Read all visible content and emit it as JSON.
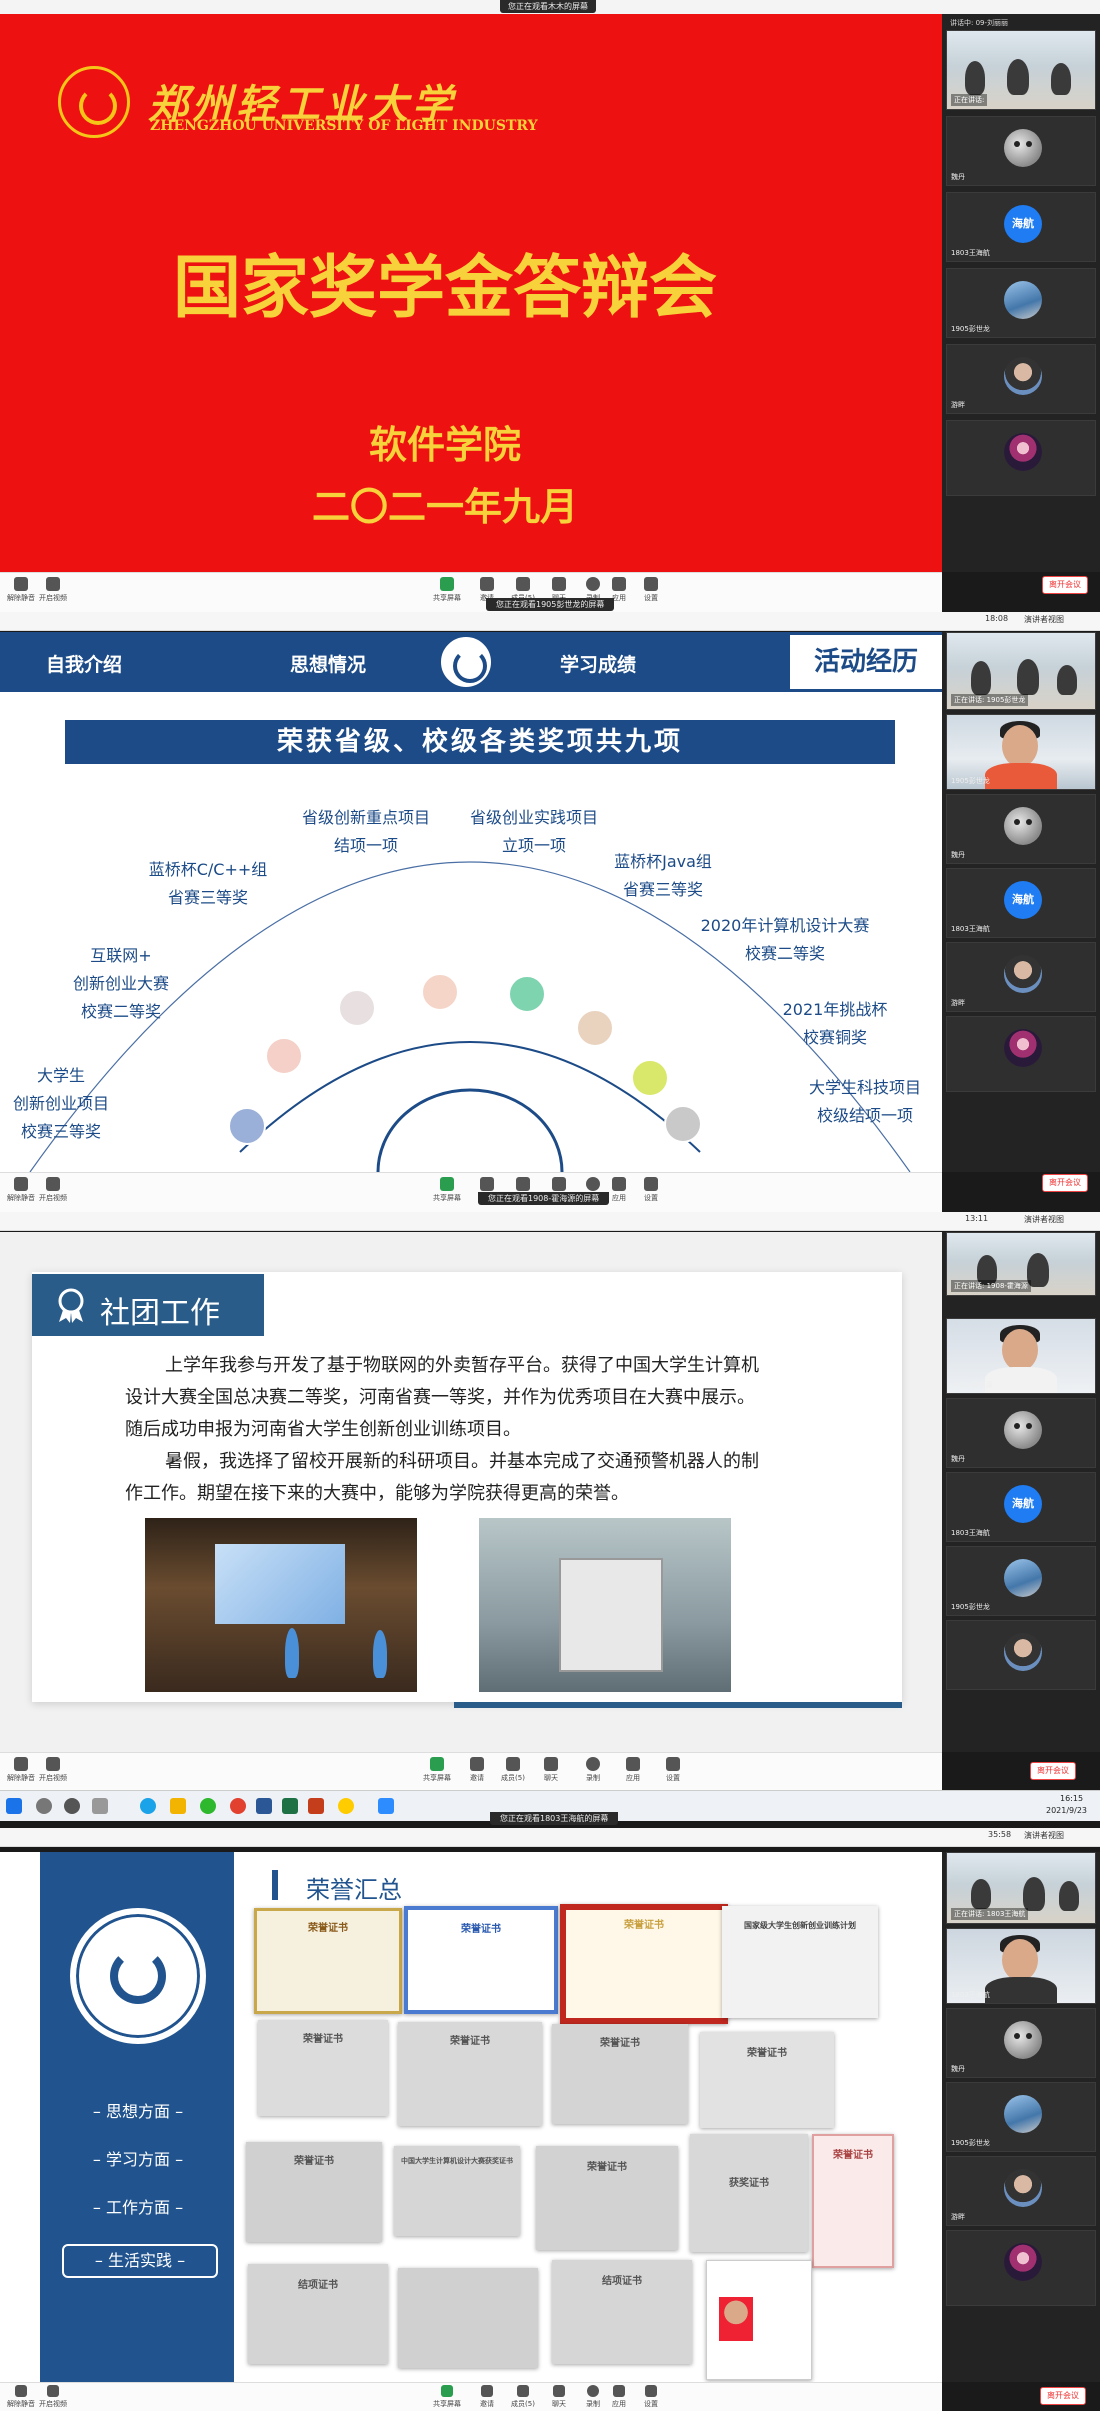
{
  "meeting": {
    "viewing_banners": [
      "您正在观看木木的屏幕",
      "您正在观看1905彭世龙的屏幕",
      "您正在观看1908-霍海源的屏幕",
      "您正在观看1803王海航的屏幕"
    ],
    "timers": [
      "18:08",
      "13:11",
      "35:58"
    ],
    "view_btn": "演讲者视图",
    "leave_label": "离开会议",
    "toolbar": {
      "mute": "解除静音",
      "video": "开启视频",
      "share": "共享屏幕",
      "invite": "邀请",
      "participants": "成员(5)",
      "chat": "聊天",
      "record": "录制",
      "apps": "应用",
      "settings": "设置"
    },
    "speaking": {
      "s1": "正在讲话:",
      "s2": "正在讲话: 1905彭世龙",
      "s3": "正在讲话: 1908-霍海源",
      "s4": "正在讲话: 1803王海航"
    },
    "sidebar_top_label": "讲话中: 09-刘丽丽",
    "participants": {
      "wei": "魏丹",
      "haihang_avatar": "海航",
      "haihang": "1803王海航",
      "shilong": "1905彭世龙",
      "haiyuan": "1908-霍海源",
      "yun": "游畔"
    },
    "clock": "16:15",
    "date": "2021/9/23"
  },
  "slide1": {
    "school_cn": "郑州轻工业大学",
    "school_en": "ZHENGZHOU UNIVERSITY OF LIGHT INDUSTRY",
    "title": "国家奖学金答辩会",
    "dept": "软件学院",
    "date": "二〇二一年九月"
  },
  "slide2": {
    "nav": [
      "自我介绍",
      "思想情况",
      "学习成绩",
      "活动经历"
    ],
    "banner": "荣获省级、校级各类奖项共九项",
    "labels": [
      {
        "l1": "大学生",
        "l2": "创新创业项目",
        "l3": "校赛三等奖"
      },
      {
        "l1": "互联网+",
        "l2": "创新创业大赛",
        "l3": "校赛二等奖"
      },
      {
        "l1": "蓝桥杯C/C++组",
        "l2": "省赛三等奖"
      },
      {
        "l1": "省级创新重点项目",
        "l2": "结项一项"
      },
      {
        "l1": "省级创业实践项目",
        "l2": "立项一项"
      },
      {
        "l1": "蓝桥杯Java组",
        "l2": "省赛三等奖"
      },
      {
        "l1": "2020年计算机设计大赛",
        "l2": "校赛二等奖"
      },
      {
        "l1": "2021年挑战杯",
        "l2": "校赛铜奖"
      },
      {
        "l1": "大学生科技项目",
        "l2": "校级结项一项"
      }
    ]
  },
  "slide3": {
    "tag": "社团工作",
    "p1a": "上学年我参与开发了基于物联网的外卖暂存平台。获得了中国大学生计算机",
    "p1b": "设计大赛全国总决赛二等奖，河南省赛一等奖，并作为优秀项目在大赛中展示。",
    "p1c": "随后成功申报为河南省大学生创新创业训练项目。",
    "p2a": "暑假，我选择了留校开展新的科研项目。并基本完成了交通预警机器人的制",
    "p2b": "作工作。期望在接下来的大赛中，能够为学院获得更高的荣誉。"
  },
  "slide4": {
    "heading": "荣誉汇总",
    "menu": [
      "思想方面",
      "学习方面",
      "工作方面",
      "生活实践"
    ],
    "certs": [
      "荣誉证书",
      "荣誉证书",
      "荣誉证书",
      "国家级大学生创新创业训练计划",
      "荣誉证书",
      "荣誉证书",
      "荣誉证书",
      "荣誉证书",
      "荣誉证书",
      "中国大学生计算机设计大赛获奖证书",
      "荣誉证书",
      "获奖证书",
      "荣誉证书",
      "结项证书",
      "结项证书"
    ]
  }
}
